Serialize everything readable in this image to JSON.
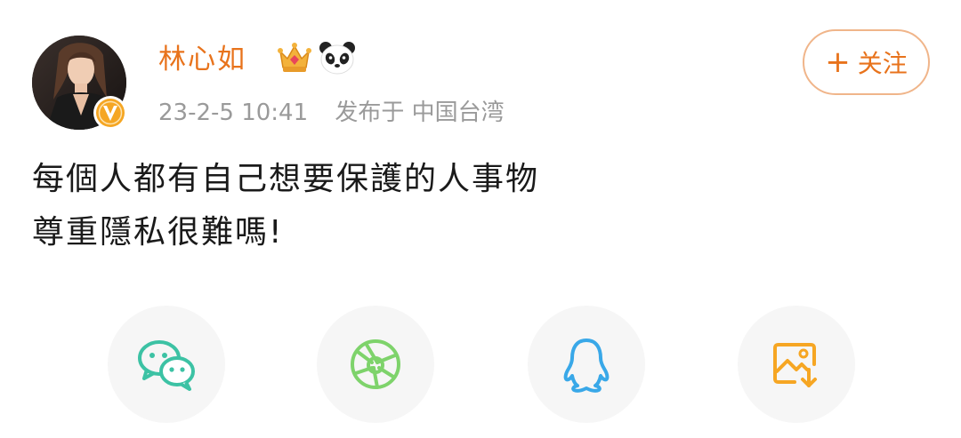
{
  "post": {
    "author": {
      "name": "林心如",
      "avatar": "avatar-photo",
      "verified_badge": "v-badge-icon",
      "badges": [
        "crown-icon",
        "panda-icon"
      ]
    },
    "meta": {
      "date": "23-2-5 10:41",
      "location": "发布于 中国台湾"
    },
    "follow_button": {
      "plus": "+",
      "label": "关注"
    },
    "content": [
      "每個人都有自己想要保護的人事物",
      "尊重隱私很難嗎!"
    ]
  },
  "share": [
    {
      "icon": "wechat-icon",
      "color": "#3cc2a4"
    },
    {
      "icon": "moments-icon",
      "color": "#7ed36b"
    },
    {
      "icon": "qq-icon",
      "color": "#39a8e8"
    },
    {
      "icon": "save-image-icon",
      "color": "#f6a623"
    }
  ],
  "colors": {
    "accent": "#e8731c",
    "meta_text": "#9a9a9a",
    "body_text": "#1a1a1a"
  }
}
